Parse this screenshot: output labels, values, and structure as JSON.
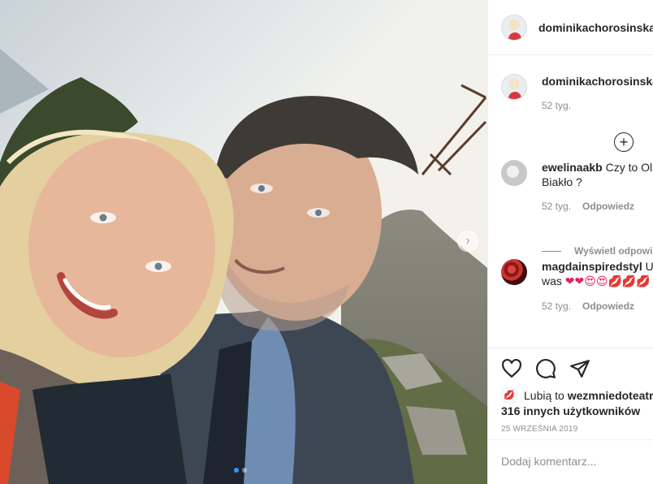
{
  "post": {
    "author": {
      "username": "dominikachorosinska"
    },
    "caption": {
      "username": "dominikachorosinska",
      "time": "52 tyg."
    },
    "photo": {
      "carousel_dots": 2,
      "active_dot": 1
    },
    "comments": [
      {
        "username": "ewelinaakb",
        "text": "Czy to Ols",
        "text2": "Biakło ?",
        "time": "52 tyg.",
        "reply_label": "Odpowiedz",
        "view_replies": "Wyświetl odpowie"
      },
      {
        "username": "magdainspiredstyl",
        "text": "Uw",
        "text2": "was",
        "emojis": "❤❤😍😍💋💋💋",
        "time": "52 tyg.",
        "reply_label": "Odpowiedz"
      }
    ],
    "likes": {
      "prefix": "Lubią to",
      "liker": "wezmniedoteatru",
      "others": "316 innych użytkowników"
    },
    "date": "25 września 2019",
    "add_comment": {
      "placeholder": "Dodaj komentarz..."
    },
    "colors": {
      "accent": "#3897f0",
      "meta_grey": "#8e8e8e"
    },
    "icons": [
      "heart-icon",
      "comment-icon",
      "share-icon",
      "add-icon",
      "chevron-right-icon"
    ]
  }
}
